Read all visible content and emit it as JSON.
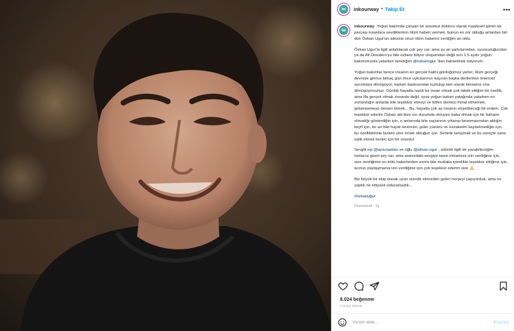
{
  "header": {
    "avatar_text": "iw",
    "username": "inkourway",
    "separator": "•",
    "follow_label": "Takip Et",
    "more_label": "•••"
  },
  "caption": {
    "username": "inkourway",
    "p1": "Yoğun bakımda çalışan bir anestezi doktoru olarak maalesef işimin bir parçası insanlara sevdiklerinin ölüm haberi vermek, bunun en zor olduğu anlardan biri dün Özkan Ugur'un ailesine onun ölüm haberini verdiğim an oldu.",
    "p2_before": "Özkan Ugur'la ilgili anlatılacak çok şey var, ama şu an şarkılarından, oyunculuğundan ya da Ali Desidero'yu bile ezbere biliyor oluşumdan değil son 1.5 aydır yoğun bakımımızda yatarken tanıdığım ",
    "p2_mention": "@ozkanugur",
    "p2_after": " 'dan bahsetmek istiyorum.",
    "p3": "Yoğun bakımlar bence insanın en gerçek halini gördüğümüz yerler, ölüm gerçeği devreye girince birkaç gün önce uykularınızı kaçıran başka dertlerinizi önemsiz ayrıntılara dönüşüyor, toplum baskısından kurtulup tam olarak kimseniz ona dönüşüyorsunuz. Günlük hayatta nazik bir insan olmak çok takdir ettiğim bir özellik, ama illa gerçek olmak zorunda değil, oysa yoğun bakım yatağında yatarken en zorlandığın anlarda bile teşekkür etmeyi ve lütfen demeyi ihmal etmemek, gülümsemeye devam etmek... Bu, hayatta çok az insanın erişebileceği bir erdem. Çok teşekkür ederim Özkan abi bize zor durumda olmanın kaba olmak için bir bahane olmadığı gösterdiğin için, o anlarında bile saçlarının yıkanıp taranmasından aldığın keyif için, bir an bile hayat sevincini, güler yüzünü ve nezaketini kaybetmediğin için, bu özelliklerinle bizlere yine örnek olduğun için. Seninle tanışmak ve bu süreçte sana eşlik etmek benim için bir onurdu!",
    "p4_a": "Sevgili eşi ",
    "p4_mention1": "@aysunaslan",
    "p4_b": " ve oğlu ",
    "p4_mention2": "@alisan.ugur",
    "p4_c": " , sizlerle ilgili de yazabileceğim tonlarca güzel şey var, ama aranızdaki sevgiye tanık olmamıza izin verdiğiniz için, size verdiğimiz en kötü haberlerden sonra bile mutlaka içtenlikle teşekkür ettiğiniz için, acınızı paylaşmama izin verdiğiniz için çok teşekkür ederim size 🙏",
    "p5": "Biz büyük bir ekip olarak uzun süredir elimizden gelen herşeyi yapıyorduk, ama ne yaptık ne ettiysek olduramadık...",
    "hashtag": "#özkanuğur",
    "edited": "Düzenlendi · 1g"
  },
  "likes": "8.024 beğenme",
  "time": "1 GÜN ÖNCE",
  "comment": {
    "placeholder": "Yorum ekle...",
    "post_label": "Paylaş"
  },
  "colors": {
    "link": "#0095f6",
    "mention": "#00376b",
    "muted": "#8e8e8e",
    "avatar_ring": "#c13584"
  }
}
